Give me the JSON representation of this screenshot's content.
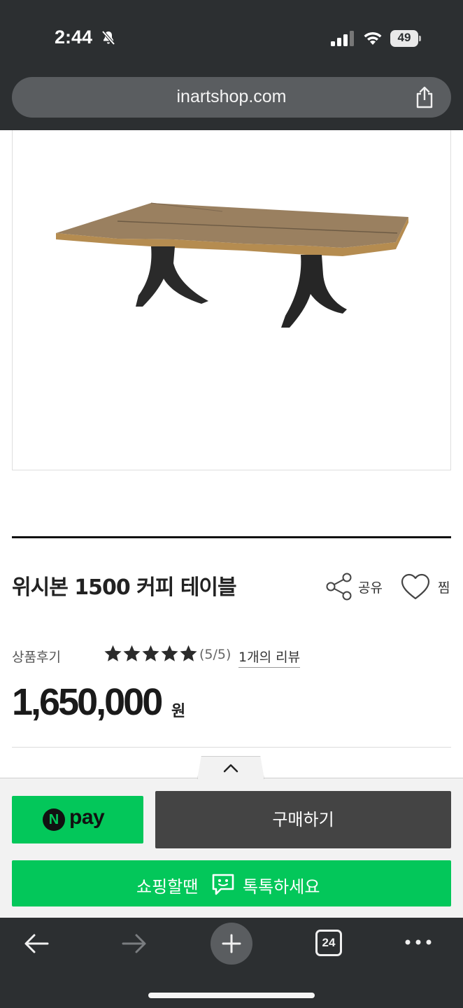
{
  "status_bar": {
    "time": "2:44",
    "battery": "49"
  },
  "browser": {
    "url": "inartshop.com",
    "tab_count": "24"
  },
  "product": {
    "title": "위시본 1500 커피 테이블",
    "share_label": "공유",
    "wish_label": "찜",
    "review_label": "상품후기",
    "rating": 5,
    "rating_text": "(5/5)",
    "review_count_text": "1개의 리뷰",
    "price": "1,650,000",
    "price_unit": "원"
  },
  "purchase": {
    "npay_n": "N",
    "npay_label": "pay",
    "buy_label": "구매하기",
    "talk_left": "쇼핑할땐",
    "talk_right": "톡톡하세요"
  },
  "colors": {
    "naver_green": "#03c75a",
    "buy_button": "#444444",
    "browser_chrome": "#2c2f31"
  }
}
